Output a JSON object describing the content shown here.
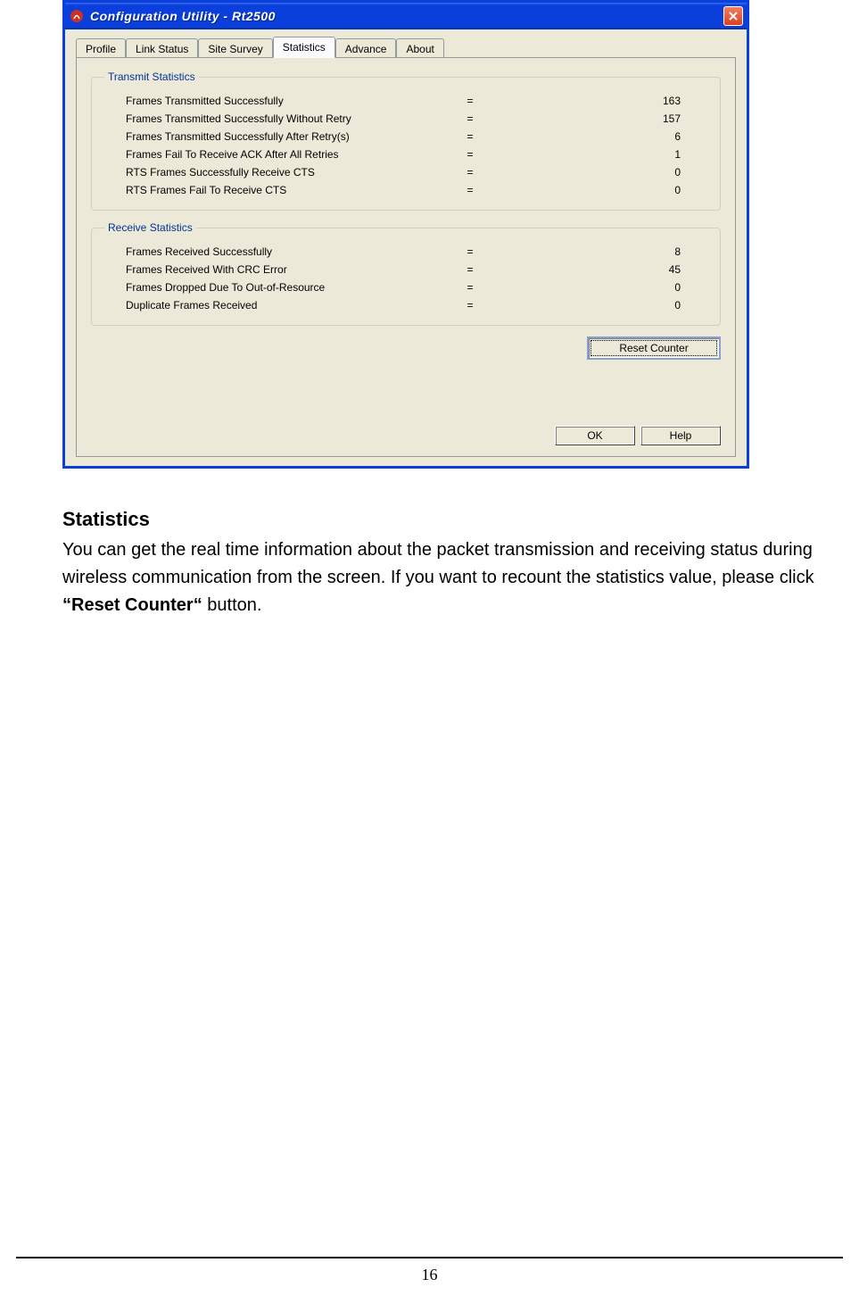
{
  "window": {
    "title": "Configuration Utility - Rt2500",
    "tabs": [
      "Profile",
      "Link Status",
      "Site Survey",
      "Statistics",
      "Advance",
      "About"
    ],
    "active_tab_index": 3,
    "transmit": {
      "legend": "Transmit Statistics",
      "rows": [
        {
          "label": "Frames Transmitted Successfully",
          "value": "163"
        },
        {
          "label": "Frames Transmitted Successfully  Without Retry",
          "value": "157"
        },
        {
          "label": "Frames Transmitted Successfully After Retry(s)",
          "value": "6"
        },
        {
          "label": "Frames Fail To Receive ACK After All Retries",
          "value": "1"
        },
        {
          "label": "RTS Frames Successfully Receive CTS",
          "value": "0"
        },
        {
          "label": "RTS Frames Fail To Receive CTS",
          "value": "0"
        }
      ]
    },
    "receive": {
      "legend": "Receive Statistics",
      "rows": [
        {
          "label": "Frames Received Successfully",
          "value": "8"
        },
        {
          "label": "Frames Received With CRC Error",
          "value": "45"
        },
        {
          "label": "Frames Dropped Due To Out-of-Resource",
          "value": "0"
        },
        {
          "label": "Duplicate Frames Received",
          "value": "0"
        }
      ]
    },
    "eq": "=",
    "reset_label": "Reset Counter",
    "ok_label": "OK",
    "help_label": "Help"
  },
  "doc": {
    "heading": "Statistics",
    "para_pre": "You can get the real time information about the packet transmission and receiving status during wireless communication from the screen. If you want to recount the statistics value, please click ",
    "para_bold": "“Reset Counter“",
    "para_post": " button."
  },
  "page_number": "16"
}
